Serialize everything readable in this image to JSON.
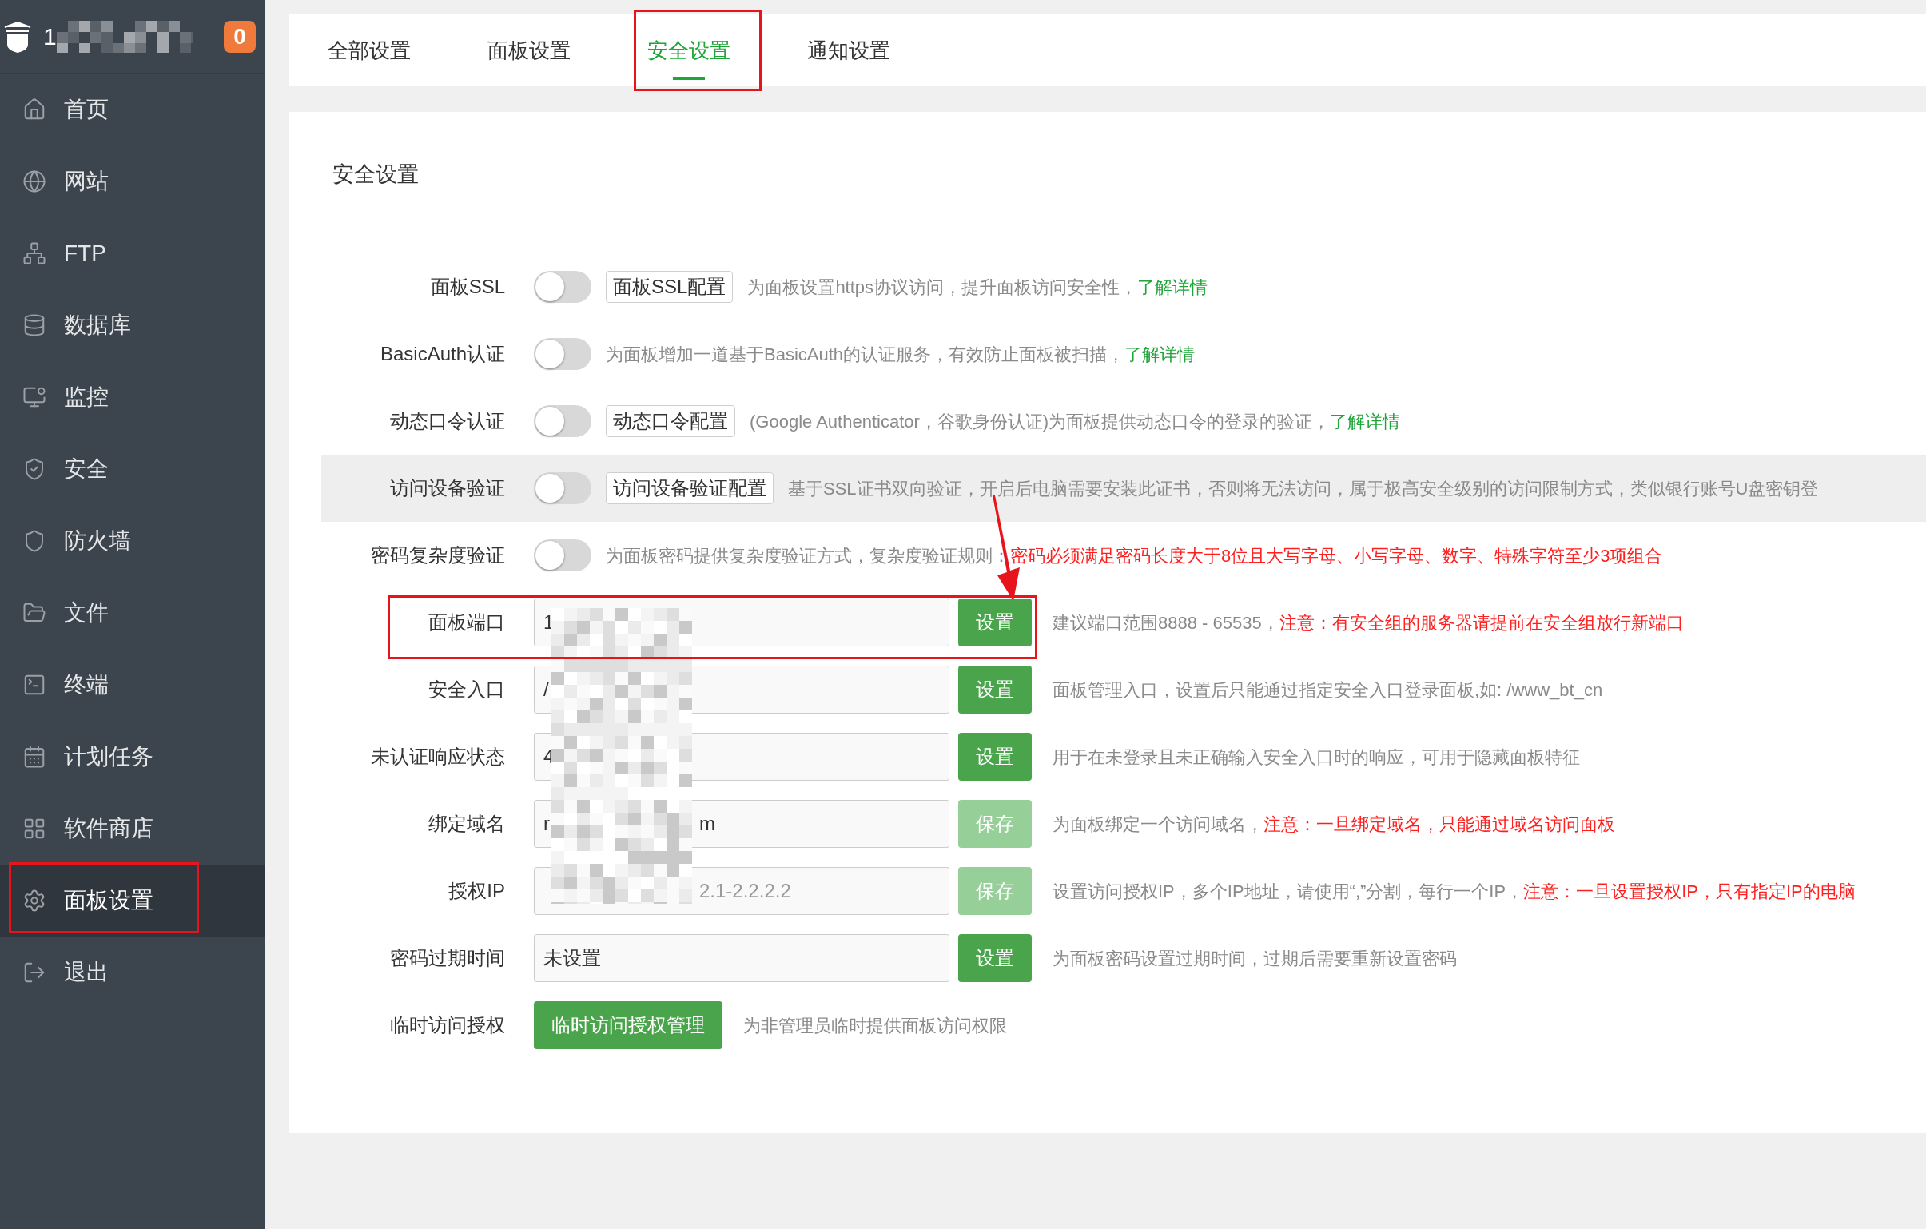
{
  "sidebar": {
    "brand": "1",
    "badge": "0",
    "items": [
      {
        "label": "首页",
        "selected": false
      },
      {
        "label": "网站",
        "selected": false
      },
      {
        "label": "FTP",
        "selected": false
      },
      {
        "label": "数据库",
        "selected": false
      },
      {
        "label": "监控",
        "selected": false
      },
      {
        "label": "安全",
        "selected": false
      },
      {
        "label": "防火墙",
        "selected": false
      },
      {
        "label": "文件",
        "selected": false
      },
      {
        "label": "终端",
        "selected": false
      },
      {
        "label": "计划任务",
        "selected": false
      },
      {
        "label": "软件商店",
        "selected": false
      },
      {
        "label": "面板设置",
        "selected": true
      },
      {
        "label": "退出",
        "selected": false
      }
    ]
  },
  "tabs": [
    {
      "label": "全部设置",
      "selected": false
    },
    {
      "label": "面板设置",
      "selected": false
    },
    {
      "label": "安全设置",
      "selected": true
    },
    {
      "label": "通知设置",
      "selected": false
    }
  ],
  "section_title": "安全设置",
  "rows": [
    {
      "kind": "toggle",
      "label": "面板SSL",
      "on": false,
      "hovered": false,
      "config": "面板SSL配置",
      "description": [
        {
          "text": "为面板设置https协议访问，提升面板访问安全性，",
          "kind": "text"
        },
        {
          "text": "了解详情",
          "kind": "link"
        }
      ]
    },
    {
      "kind": "toggle",
      "label": "BasicAuth认证",
      "on": false,
      "hovered": false,
      "description": [
        {
          "text": "为面板增加一道基于BasicAuth的认证服务，有效防止面板被扫描，",
          "kind": "text"
        },
        {
          "text": "了解详情",
          "kind": "link"
        }
      ]
    },
    {
      "kind": "toggle",
      "label": "动态口令认证",
      "on": false,
      "hovered": false,
      "config": "动态口令配置",
      "description": [
        {
          "text": "(Google Authenticator，谷歌身份认证)为面板提供动态口令的登录的验证，",
          "kind": "text"
        },
        {
          "text": "了解详情",
          "kind": "link"
        }
      ]
    },
    {
      "kind": "toggle",
      "label": "访问设备验证",
      "on": false,
      "hovered": true,
      "config": "访问设备验证配置",
      "description": [
        {
          "text": "基于SSL证书双向验证，开启后电脑需要安装此证书，否则将无法访问，属于极高安全级别的访问限制方式，类似银行账号U盘密钥登",
          "kind": "text"
        }
      ]
    },
    {
      "kind": "toggle",
      "label": "密码复杂度验证",
      "on": false,
      "hovered": false,
      "description": [
        {
          "text": "为面板密码提供复杂度验证方式，复杂度验证规则：",
          "kind": "text"
        },
        {
          "text": "密码必须满足密码长度大于8位且大写字母、小写字母、数字、特殊字符至少3项组合",
          "kind": "warning"
        }
      ]
    },
    {
      "kind": "input",
      "label": "面板端口",
      "hovered": false,
      "value": "1",
      "button": {
        "label": "设置",
        "disabled": false
      },
      "description": [
        {
          "text": "建议端口范围8888 - 65535，",
          "kind": "text"
        },
        {
          "text": "注意：有安全组的服务器请提前在安全组放行新端口",
          "kind": "warning"
        }
      ]
    },
    {
      "kind": "input",
      "label": "安全入口",
      "hovered": false,
      "value": "/",
      "button": {
        "label": "设置",
        "disabled": false
      },
      "description": [
        {
          "text": "面板管理入口，设置后只能通过指定安全入口登录面板,如: /www_bt_cn",
          "kind": "text"
        }
      ]
    },
    {
      "kind": "input",
      "label": "未认证响应状态",
      "hovered": false,
      "value": "4",
      "button": {
        "label": "设置",
        "disabled": false
      },
      "description": [
        {
          "text": "用于在未登录且未正确输入安全入口时的响应，可用于隐藏面板特征",
          "kind": "text"
        }
      ]
    },
    {
      "kind": "input",
      "label": "绑定域名",
      "hovered": false,
      "value": "r",
      "value_tail": "m",
      "button": {
        "label": "保存",
        "disabled": true
      },
      "description": [
        {
          "text": "为面板绑定一个访问域名，",
          "kind": "text"
        },
        {
          "text": "注意：一旦绑定域名，只能通过域名访问面板",
          "kind": "warning"
        }
      ]
    },
    {
      "kind": "input",
      "label": "授权IP",
      "hovered": false,
      "placeholder": "2.1-2.2.2.2",
      "button": {
        "label": "保存",
        "disabled": true
      },
      "description": [
        {
          "text": "设置访问授权IP，多个IP地址，请使用“,”分割，每行一个IP，",
          "kind": "text"
        },
        {
          "text": "注意：一旦设置授权IP，只有指定IP的电脑",
          "kind": "warning"
        }
      ]
    },
    {
      "kind": "input",
      "label": "密码过期时间",
      "hovered": false,
      "value": "未设置",
      "button": {
        "label": "设置",
        "disabled": false
      },
      "description": [
        {
          "text": "为面板密码设置过期时间，过期后需要重新设置密码",
          "kind": "text"
        }
      ]
    },
    {
      "kind": "button",
      "label": "临时访问授权",
      "button": {
        "label": "临时访问授权管理",
        "disabled": false
      },
      "hovered": false,
      "description": [
        {
          "text": "为非管理员临时提供面板访问权限",
          "kind": "text"
        }
      ]
    }
  ]
}
